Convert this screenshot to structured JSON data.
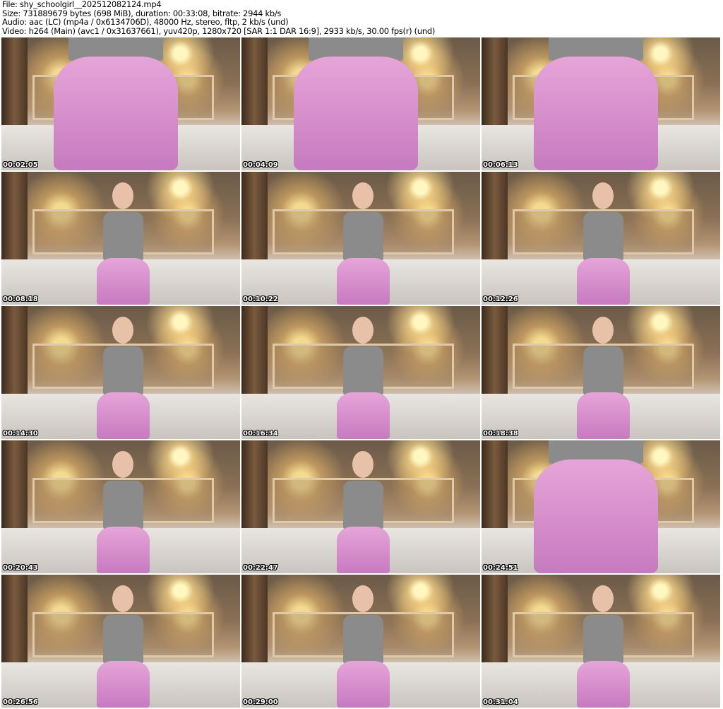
{
  "header": {
    "file_line": "File: shy_schoolgirl__202512082124.mp4",
    "size_line": "Size: 731889679 bytes (698 MiB), duration: 00:33:08, bitrate: 2944 kb/s",
    "audio_line": "Audio: aac (LC) (mp4a / 0x6134706D), 48000 Hz, stereo, fltp, 2 kb/s (und)",
    "video_line": "Video: h264 (Main) (avc1 / 0x31637661), yuv420p, 1280x720 [SAR 1:1 DAR 16:9], 2933 kb/s, 30.00 fps(r) (und)"
  },
  "thumbnails": [
    {
      "timestamp": "00:02:05",
      "shot": "close"
    },
    {
      "timestamp": "00:04:09",
      "shot": "close"
    },
    {
      "timestamp": "00:06:13",
      "shot": "close"
    },
    {
      "timestamp": "00:08:18",
      "shot": "wide"
    },
    {
      "timestamp": "00:10:22",
      "shot": "wide"
    },
    {
      "timestamp": "00:12:26",
      "shot": "wide"
    },
    {
      "timestamp": "00:14:30",
      "shot": "wide"
    },
    {
      "timestamp": "00:16:34",
      "shot": "wide"
    },
    {
      "timestamp": "00:18:38",
      "shot": "wide"
    },
    {
      "timestamp": "00:20:43",
      "shot": "wide"
    },
    {
      "timestamp": "00:22:47",
      "shot": "wide"
    },
    {
      "timestamp": "00:24:51",
      "shot": "close"
    },
    {
      "timestamp": "00:26:56",
      "shot": "wide"
    },
    {
      "timestamp": "00:29:00",
      "shot": "wide"
    },
    {
      "timestamp": "00:31:04",
      "shot": "wide"
    }
  ]
}
